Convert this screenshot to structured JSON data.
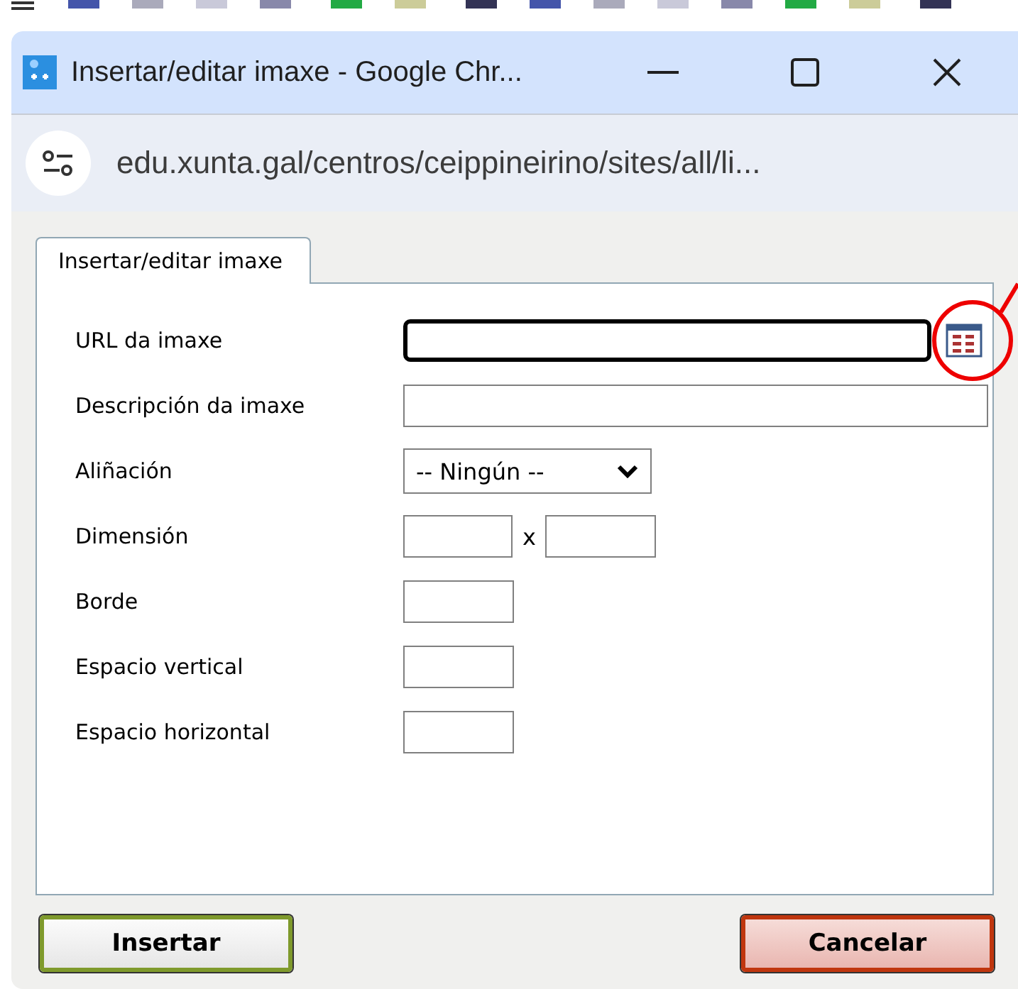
{
  "window": {
    "title": "Insertar/editar imaxe - Google Chr..."
  },
  "address_bar": {
    "url": "edu.xunta.gal/centros/ceippineirino/sites/all/li..."
  },
  "tabs": [
    {
      "label": "Insertar/editar imaxe",
      "selected": true
    }
  ],
  "form": {
    "rows": [
      {
        "kind": "url",
        "label": "URL da imaxe",
        "focused": true
      },
      {
        "kind": "text",
        "label": "Descripción da imaxe"
      },
      {
        "kind": "select",
        "label": "Aliñación",
        "value": "-- Ningún --"
      },
      {
        "kind": "pair",
        "label": "Dimensión",
        "separator": "x"
      },
      {
        "kind": "small",
        "label": "Borde"
      },
      {
        "kind": "small",
        "label": "Espacio vertical"
      },
      {
        "kind": "small",
        "label": "Espacio horizontal"
      }
    ]
  },
  "buttons": [
    {
      "label": "Insertar",
      "kind": "confirm"
    },
    {
      "label": "Cancelar",
      "kind": "cancel"
    }
  ]
}
